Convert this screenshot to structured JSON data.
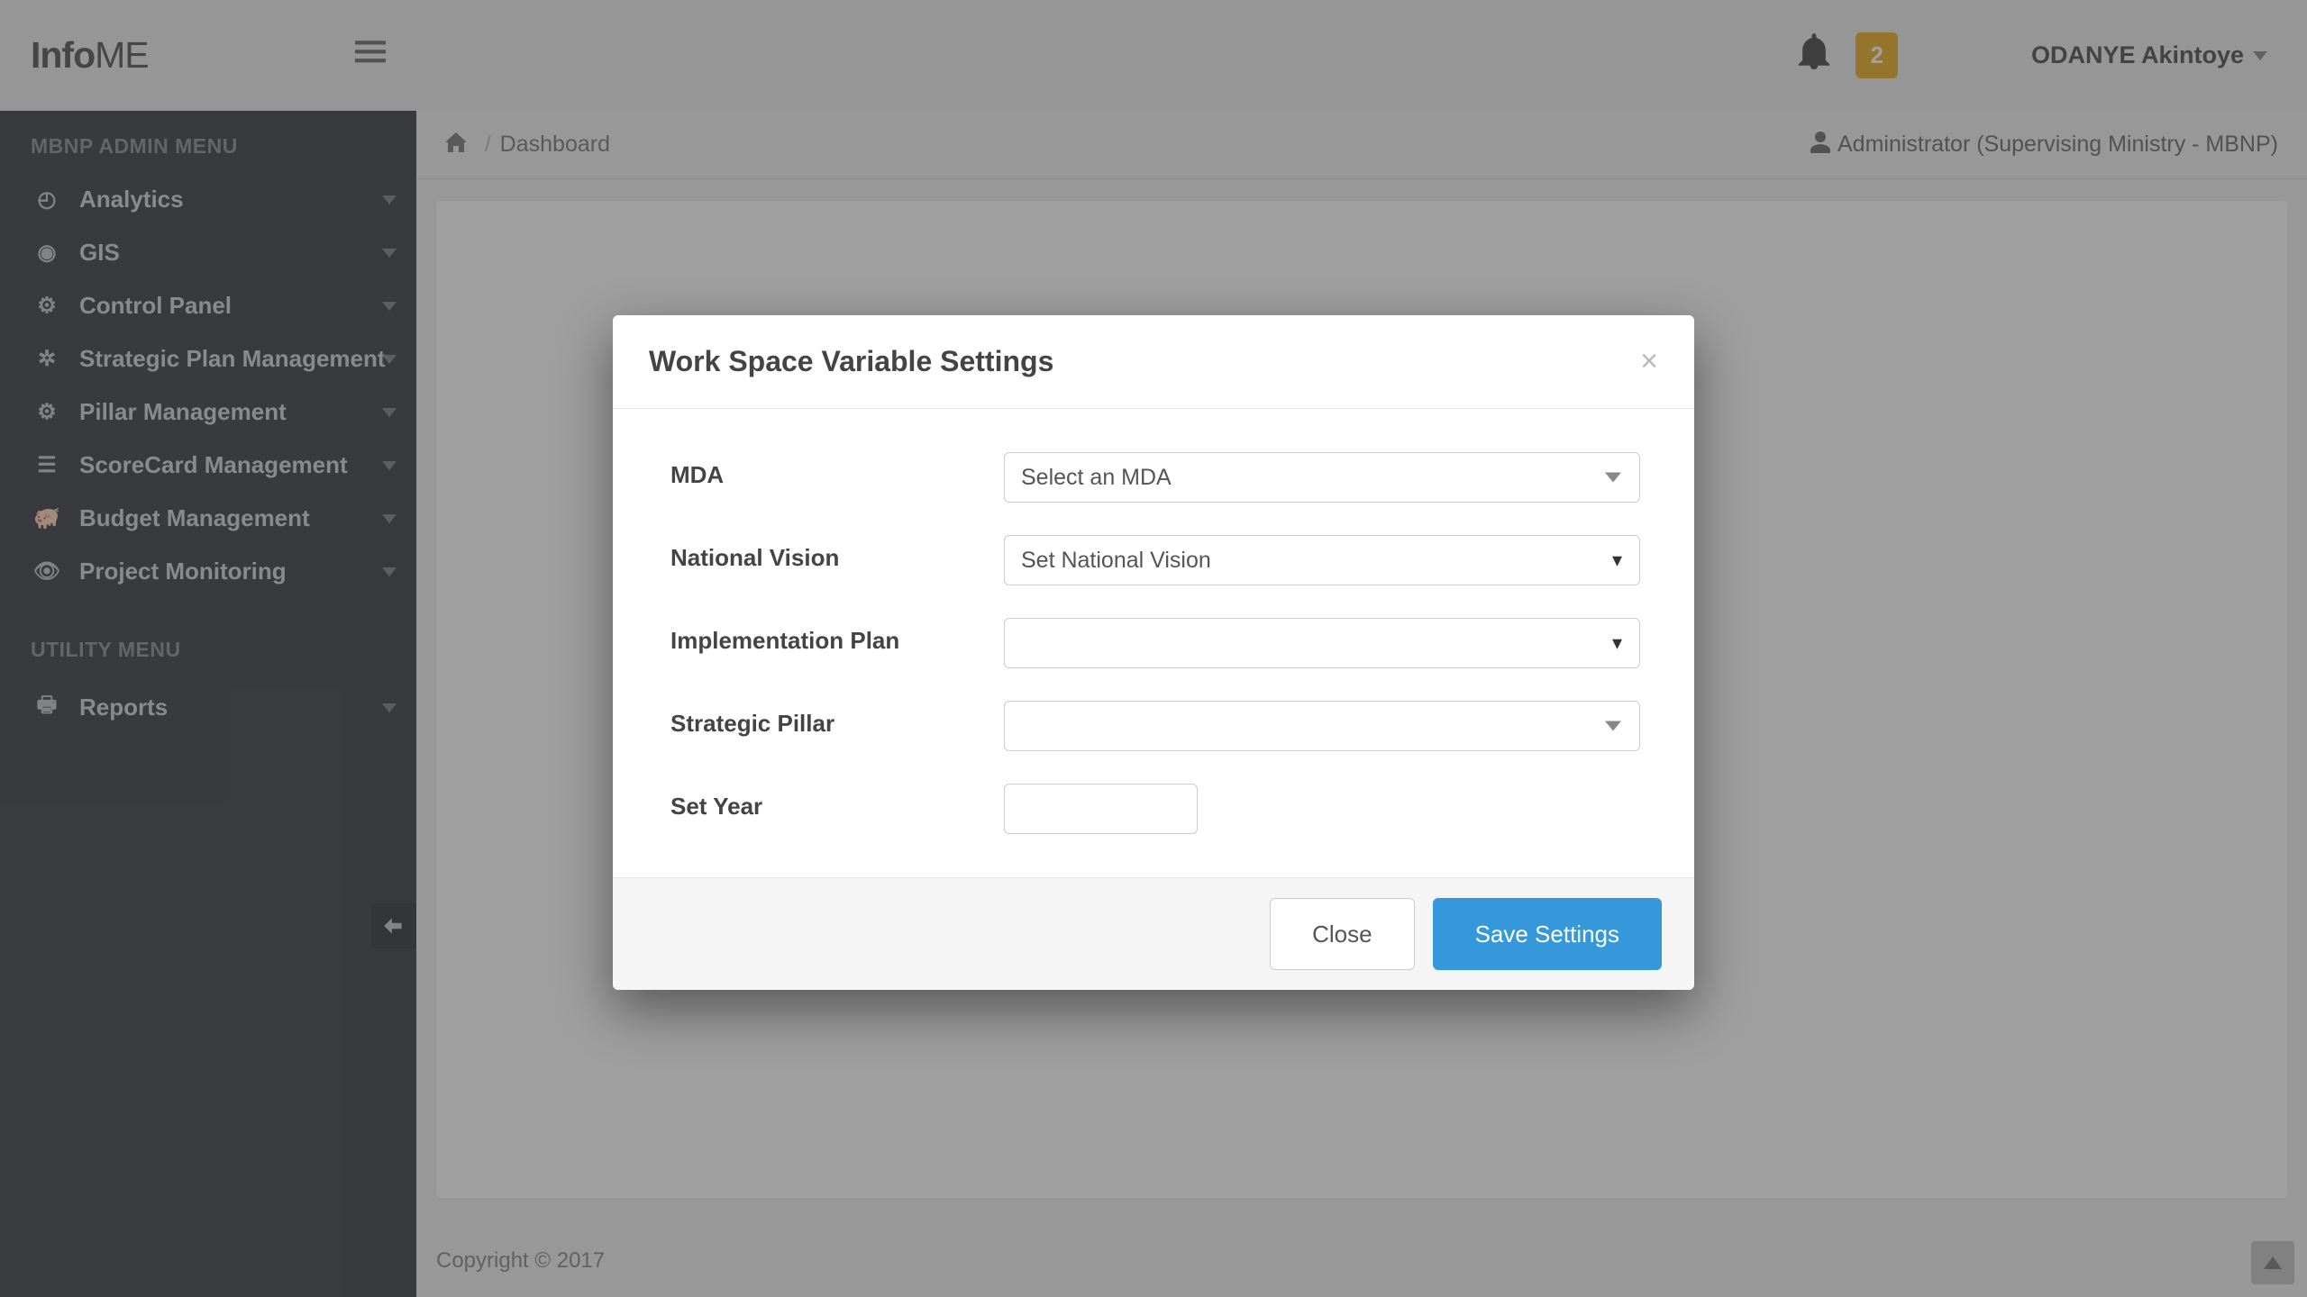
{
  "brand": {
    "first": "Info",
    "second": "ME"
  },
  "header": {
    "badge_count": "2",
    "user_name": "ODANYE Akintoye"
  },
  "sidebar": {
    "section_admin": "MBNP ADMIN MENU",
    "section_utility": "UTILITY MENU",
    "items": [
      {
        "label": "Analytics"
      },
      {
        "label": "GIS"
      },
      {
        "label": "Control Panel"
      },
      {
        "label": "Strategic Plan Management"
      },
      {
        "label": "Pillar Management"
      },
      {
        "label": "ScoreCard Management"
      },
      {
        "label": "Budget Management"
      },
      {
        "label": "Project Monitoring"
      }
    ],
    "utility_items": [
      {
        "label": "Reports"
      }
    ]
  },
  "breadcrumb": {
    "current": "Dashboard"
  },
  "role_text": "Administrator (Supervising Ministry - MBNP)",
  "footer": "Copyright © 2017",
  "modal": {
    "title": "Work Space Variable Settings",
    "labels": {
      "mda": "MDA",
      "national_vision": "National Vision",
      "implementation_plan": "Implementation Plan",
      "strategic_pillar": "Strategic Pillar",
      "set_year": "Set Year"
    },
    "values": {
      "mda_placeholder": "Select an MDA",
      "national_vision_selected": "Set National Vision",
      "implementation_plan_selected": "",
      "strategic_pillar_placeholder": "",
      "set_year_value": ""
    },
    "buttons": {
      "close": "Close",
      "save": "Save Settings"
    }
  }
}
